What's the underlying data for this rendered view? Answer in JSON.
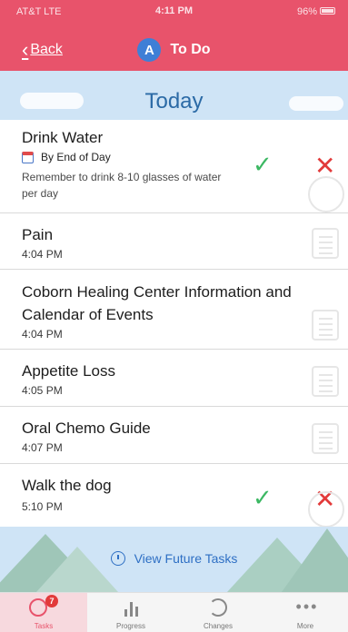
{
  "status": {
    "carrier": "AT&T  LTE",
    "time": "4:11 PM",
    "battery": "96%"
  },
  "nav": {
    "back_label": "Back",
    "avatar_letter": "A",
    "title": "To Do"
  },
  "section": {
    "label": "Today"
  },
  "tasks": [
    {
      "name": "Drink Water",
      "due": "By End of Day",
      "note": "Remember to drink 8-10 glasses of water per day"
    },
    {
      "name": "Pain",
      "time": "4:04 PM"
    },
    {
      "name": "Coborn Healing Center Information and Calendar of Events",
      "time": "4:04 PM"
    },
    {
      "name": "Appetite Loss",
      "time": "4:05 PM"
    },
    {
      "name": "Oral Chemo Guide",
      "time": "4:07 PM"
    },
    {
      "name": "Walk the dog",
      "time": "5:10 PM"
    }
  ],
  "future": {
    "label": "View Future Tasks"
  },
  "tabs": [
    {
      "label": "Tasks",
      "badge": "7"
    },
    {
      "label": "Progress"
    },
    {
      "label": "Changes"
    },
    {
      "label": "More"
    }
  ],
  "icons": {
    "back": "chevron-left-icon",
    "calendar": "calendar-icon",
    "complete": "checkmark-icon",
    "dismiss": "close-icon",
    "document": "document-icon",
    "heart": "heart-icon",
    "clock": "clock-icon"
  },
  "colors": {
    "accent": "#e8536b",
    "sky": "#cfe4f6",
    "link": "#2e6fc4",
    "check": "#3cb863",
    "cross": "#e23a3a"
  }
}
